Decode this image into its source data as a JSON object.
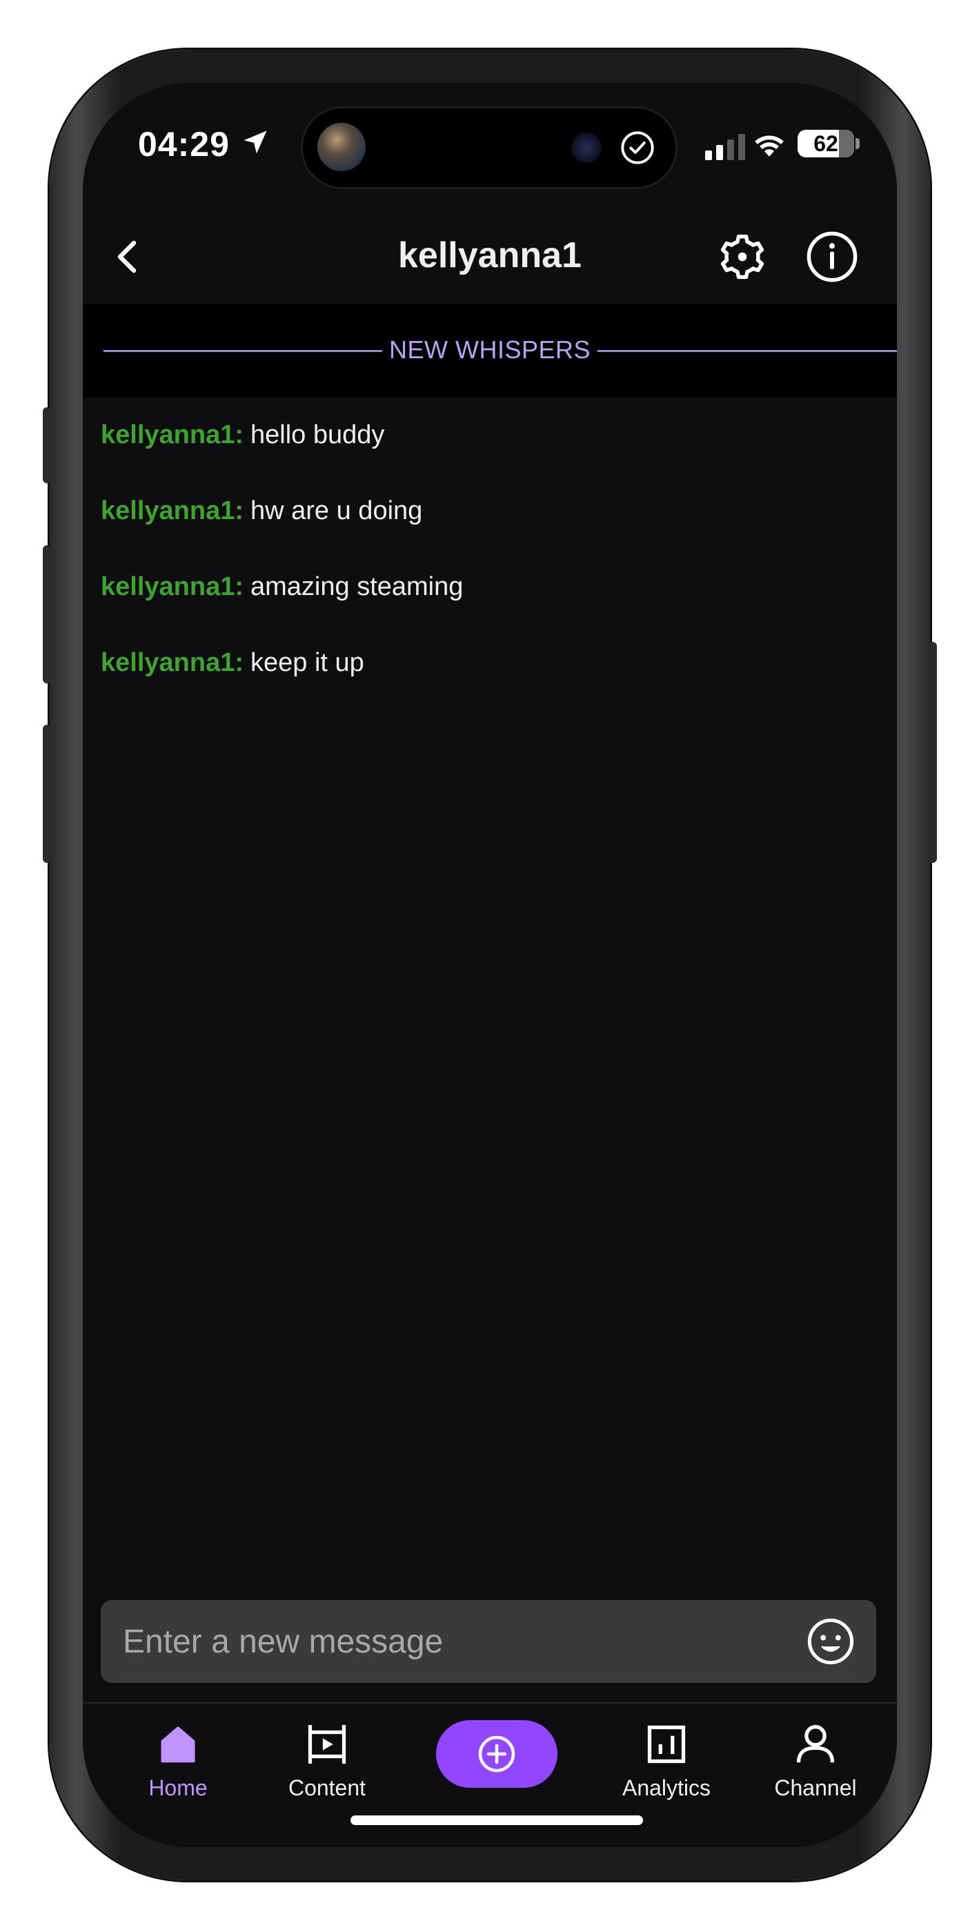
{
  "status_bar": {
    "time": "04:29",
    "battery": "62"
  },
  "header": {
    "title": "kellyanna1"
  },
  "divider": {
    "label": "NEW WHISPERS"
  },
  "messages": [
    {
      "user": "kellyanna1:",
      "text": "hello buddy"
    },
    {
      "user": "kellyanna1:",
      "text": "hw are u doing"
    },
    {
      "user": "kellyanna1:",
      "text": "amazing steaming"
    },
    {
      "user": "kellyanna1:",
      "text": "keep it up"
    }
  ],
  "composer": {
    "placeholder": "Enter a new message",
    "value": ""
  },
  "nav": {
    "home": "Home",
    "content": "Content",
    "analytics": "Analytics",
    "channel": "Channel",
    "active": "home"
  },
  "colors": {
    "background": "#0e0e10",
    "accent": "#9147ff",
    "accent_text": "#bf94ff",
    "username": "#3fa42f",
    "divider": "#b9a3f2"
  },
  "icons": {
    "back": "chevron-left-icon",
    "settings": "gear-icon",
    "info": "info-circle-icon",
    "emoji": "smiley-icon",
    "home": "home-icon",
    "content": "film-frame-icon",
    "create": "plus-circle-icon",
    "analytics": "bar-chart-icon",
    "channel": "person-icon"
  }
}
